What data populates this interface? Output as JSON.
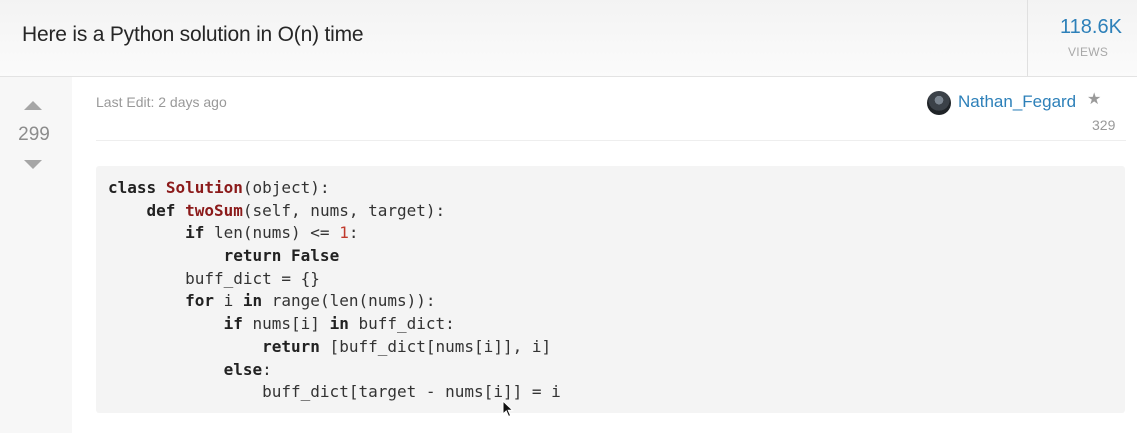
{
  "post": {
    "title": "Here is a Python solution in O(n) time",
    "views_count": "118.6K",
    "views_label": "VIEWS",
    "votes": "299",
    "last_edit": "Last Edit: 2 days ago",
    "author": {
      "name": "Nathan_Fegard",
      "reputation": "329",
      "star_icon": "star-icon",
      "avatar_icon": "avatar"
    }
  },
  "code": {
    "lines": [
      [
        {
          "t": "class",
          "c": "kw"
        },
        {
          "t": " "
        },
        {
          "t": "Solution",
          "c": "cls"
        },
        {
          "t": "(object):"
        }
      ],
      [
        {
          "t": "    "
        },
        {
          "t": "def",
          "c": "kw"
        },
        {
          "t": " "
        },
        {
          "t": "twoSum",
          "c": "fn"
        },
        {
          "t": "(self, nums, target):"
        }
      ],
      [
        {
          "t": "        "
        },
        {
          "t": "if",
          "c": "kw"
        },
        {
          "t": " len(nums) <= "
        },
        {
          "t": "1",
          "c": "num"
        },
        {
          "t": ":"
        }
      ],
      [
        {
          "t": "            "
        },
        {
          "t": "return",
          "c": "kw"
        },
        {
          "t": " "
        },
        {
          "t": "False",
          "c": "kw"
        }
      ],
      [
        {
          "t": "        buff_dict = {}"
        }
      ],
      [
        {
          "t": "        "
        },
        {
          "t": "for",
          "c": "kw"
        },
        {
          "t": " i "
        },
        {
          "t": "in",
          "c": "kw"
        },
        {
          "t": " range(len(nums)):"
        }
      ],
      [
        {
          "t": "            "
        },
        {
          "t": "if",
          "c": "kw"
        },
        {
          "t": " nums[i] "
        },
        {
          "t": "in",
          "c": "kw"
        },
        {
          "t": " buff_dict:"
        }
      ],
      [
        {
          "t": "                "
        },
        {
          "t": "return",
          "c": "kw"
        },
        {
          "t": " [buff_dict[nums[i]], i]"
        }
      ],
      [
        {
          "t": "            "
        },
        {
          "t": "else",
          "c": "kw"
        },
        {
          "t": ":"
        }
      ],
      [
        {
          "t": "                buff_dict[target - nums[i]] = i"
        }
      ]
    ]
  },
  "colors": {
    "link": "#2d80b9",
    "class_name": "#8b1a1a",
    "number": "#c0392b",
    "code_bg": "#f4f4f4"
  }
}
